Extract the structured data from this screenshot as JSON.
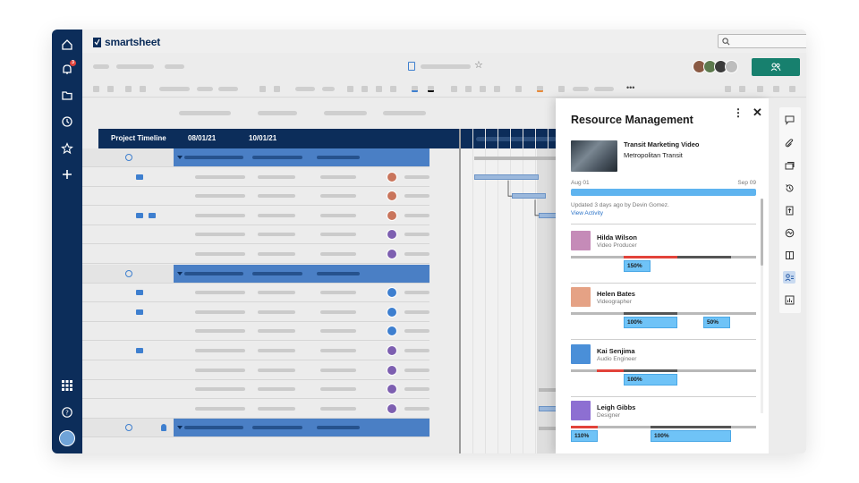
{
  "app": {
    "brand": "smartsheet"
  },
  "nav": {
    "notification_count": "3",
    "icons": [
      "home-icon",
      "bell-icon",
      "folder-icon",
      "clock-icon",
      "star-icon",
      "plus-icon",
      "grid-apps-icon",
      "help-icon"
    ]
  },
  "sheet": {
    "columns": {
      "project_timeline": "Project Timeline",
      "date1": "08/01/21",
      "date2": "10/01/21"
    }
  },
  "panel": {
    "title": "Resource Management",
    "kebab": "⋮",
    "close": "✕",
    "project": {
      "name": "Transit Marketing Video",
      "client": "Metropolitan Transit"
    },
    "date_start": "Aug 01",
    "date_end": "Sep 09",
    "updated": "Updated 3 days ago by Devin Gomez.",
    "view_activity": "View Activity",
    "people": [
      {
        "name": "Hilda Wilson",
        "role": "Video Producer",
        "allocations": [
          "150%"
        ]
      },
      {
        "name": "Helen Bates",
        "role": "Videographer",
        "allocations": [
          "100%",
          "50%"
        ]
      },
      {
        "name": "Kai Senjima",
        "role": "Audio Engineer",
        "allocations": [
          "100%"
        ]
      },
      {
        "name": "Leigh Gibbs",
        "role": "Designer",
        "allocations": [
          "110%",
          "100%"
        ]
      }
    ]
  },
  "colors": {
    "nav": "#0c2d5a",
    "accent": "#17806e",
    "allocation": "#6fc3f7",
    "over": "#e2433a"
  }
}
